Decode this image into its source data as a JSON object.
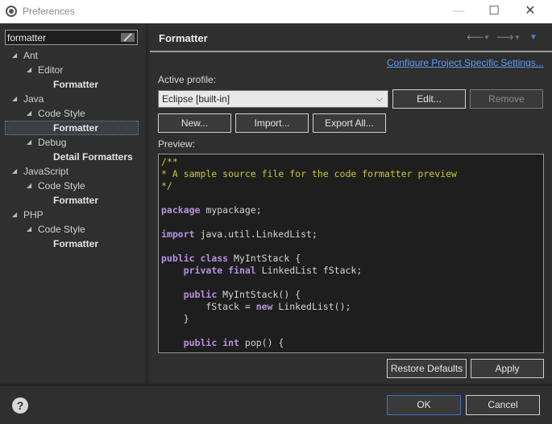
{
  "window": {
    "title": "Preferences",
    "minimize": "—",
    "maximize": "☐",
    "close": "✕"
  },
  "filter": {
    "value": "formatter"
  },
  "tree": [
    {
      "label": "Ant",
      "level": 0,
      "bold": false
    },
    {
      "label": "Editor",
      "level": 1,
      "bold": false
    },
    {
      "label": "Formatter",
      "level": 2,
      "bold": true
    },
    {
      "label": "Java",
      "level": 0,
      "bold": false
    },
    {
      "label": "Code Style",
      "level": 1,
      "bold": false
    },
    {
      "label": "Formatter",
      "level": 2,
      "bold": true,
      "selected": true
    },
    {
      "label": "Debug",
      "level": 1,
      "bold": false
    },
    {
      "label": "Detail Formatters",
      "level": 2,
      "bold": true
    },
    {
      "label": "JavaScript",
      "level": 0,
      "bold": false
    },
    {
      "label": "Code Style",
      "level": 1,
      "bold": false
    },
    {
      "label": "Formatter",
      "level": 2,
      "bold": true
    },
    {
      "label": "PHP",
      "level": 0,
      "bold": false
    },
    {
      "label": "Code Style",
      "level": 1,
      "bold": false
    },
    {
      "label": "Formatter",
      "level": 2,
      "bold": true
    }
  ],
  "page": {
    "title": "Formatter",
    "project_link": "Configure Project Specific Settings...",
    "active_profile_label": "Active profile:",
    "profile_value": "Eclipse [built-in]",
    "edit_label": "Edit...",
    "remove_label": "Remove",
    "new_label": "New...",
    "import_label": "Import...",
    "export_label": "Export All...",
    "preview_label": "Preview:",
    "restore_label": "Restore Defaults",
    "apply_label": "Apply"
  },
  "preview_code": [
    {
      "t": "/**",
      "c": "cm"
    },
    {
      "t": "* A sample source file for the code formatter preview",
      "c": "cm"
    },
    {
      "t": "*/",
      "c": "cm"
    },
    {
      "t": "",
      "c": ""
    },
    {
      "t": "package mypackage;",
      "c": "pkg"
    },
    {
      "t": "",
      "c": ""
    },
    {
      "t": "import java.util.LinkedList;",
      "c": "imp"
    },
    {
      "t": "",
      "c": ""
    },
    {
      "t": "public class MyIntStack {",
      "c": "cls"
    },
    {
      "t": "    private final LinkedList fStack;",
      "c": "fld"
    },
    {
      "t": "",
      "c": ""
    },
    {
      "t": "    public MyIntStack() {",
      "c": "ctor"
    },
    {
      "t": "        fStack = new LinkedList();",
      "c": "newl"
    },
    {
      "t": "    }",
      "c": ""
    },
    {
      "t": "",
      "c": ""
    },
    {
      "t": "    public int pop() {",
      "c": "pop"
    }
  ],
  "footer": {
    "ok_label": "OK",
    "cancel_label": "Cancel",
    "help_symbol": "?"
  },
  "icons": {
    "back": "arrow-left-icon",
    "forward": "arrow-right-icon",
    "menu": "view-menu-icon",
    "help": "help-icon",
    "clear": "clear-filter-icon"
  },
  "colors": {
    "accent": "#3d74c4",
    "link": "#5b9bf2",
    "comment": "#c8c83a",
    "keyword": "#b890e0"
  }
}
